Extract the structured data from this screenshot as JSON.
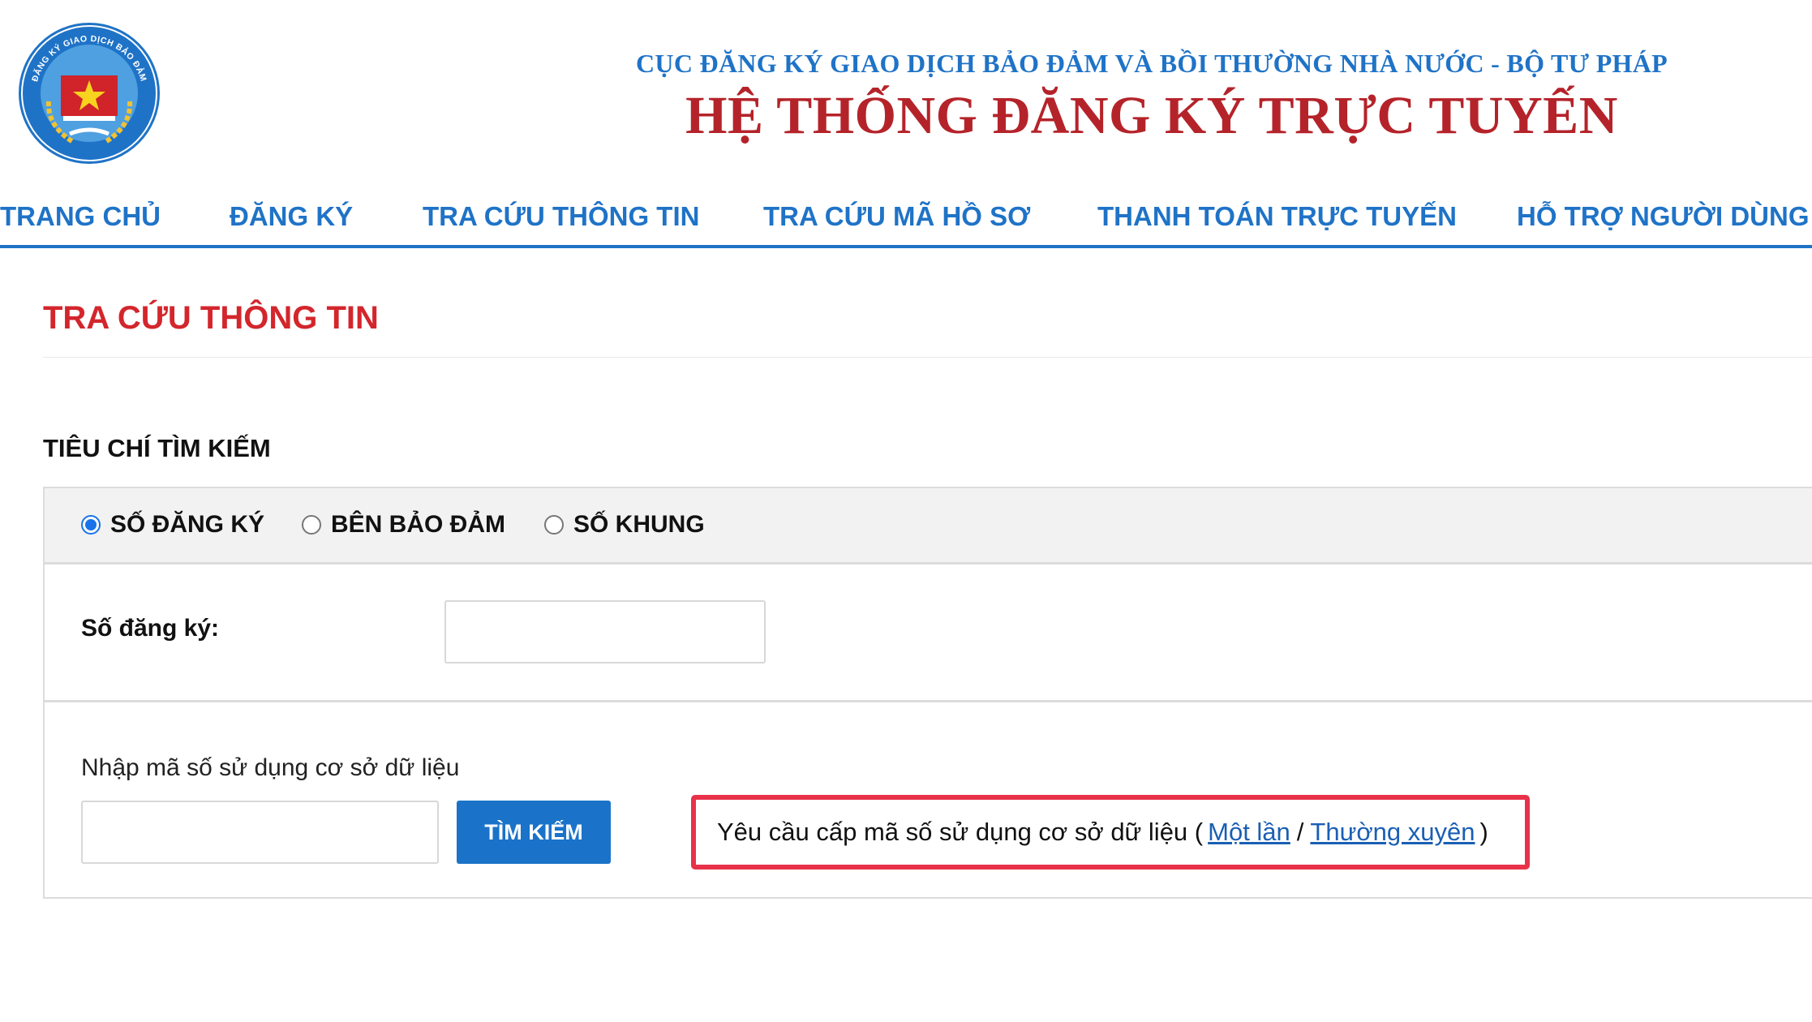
{
  "header": {
    "agency": "CỤC ĐĂNG KÝ GIAO DỊCH BẢO ĐẢM VÀ BỒI THƯỜNG NHÀ NƯỚC - BỘ TƯ PHÁP",
    "system": "HỆ THỐNG ĐĂNG KÝ TRỰC TUYẾN",
    "logo_icon": "government-seal-icon",
    "logo_text": "ĐĂNG KÝ GIAO DỊCH BẢO ĐẢM"
  },
  "nav": {
    "items": [
      {
        "label": "TRANG CHỦ"
      },
      {
        "label": "ĐĂNG KÝ"
      },
      {
        "label": "TRA CỨU THÔNG TIN"
      },
      {
        "label": "TRA CỨU MÃ HỒ SƠ"
      },
      {
        "label": "THANH TOÁN TRỰC TUYẾN"
      },
      {
        "label": "HỖ TRỢ NGƯỜI DÙNG"
      }
    ]
  },
  "page": {
    "title": "TRA CỨU THÔNG TIN",
    "criteria_heading": "TIÊU CHÍ TÌM KIẾM"
  },
  "search": {
    "options": [
      {
        "label": "SỐ ĐĂNG KÝ",
        "checked": true
      },
      {
        "label": "BÊN BẢO ĐẢM",
        "checked": false
      },
      {
        "label": "SỐ KHUNG",
        "checked": false
      }
    ],
    "reg_label": "Số đăng ký:",
    "reg_value": "",
    "code_label": "Nhập mã số sử dụng cơ sở dữ liệu",
    "code_value": "",
    "button_label": "TÌM KIẾM",
    "request_text": "Yêu cầu cấp mã số sử dụng cơ sở dữ liệu (",
    "link_once": "Một lần",
    "separator": "/",
    "link_regular": "Thường xuyên",
    "close_paren": ")"
  },
  "colors": {
    "nav_blue": "#1f73c7",
    "title_red": "#b5232a",
    "page_title_red": "#d3262c",
    "button_blue": "#1a73c9",
    "highlight_red": "#e8324a"
  }
}
